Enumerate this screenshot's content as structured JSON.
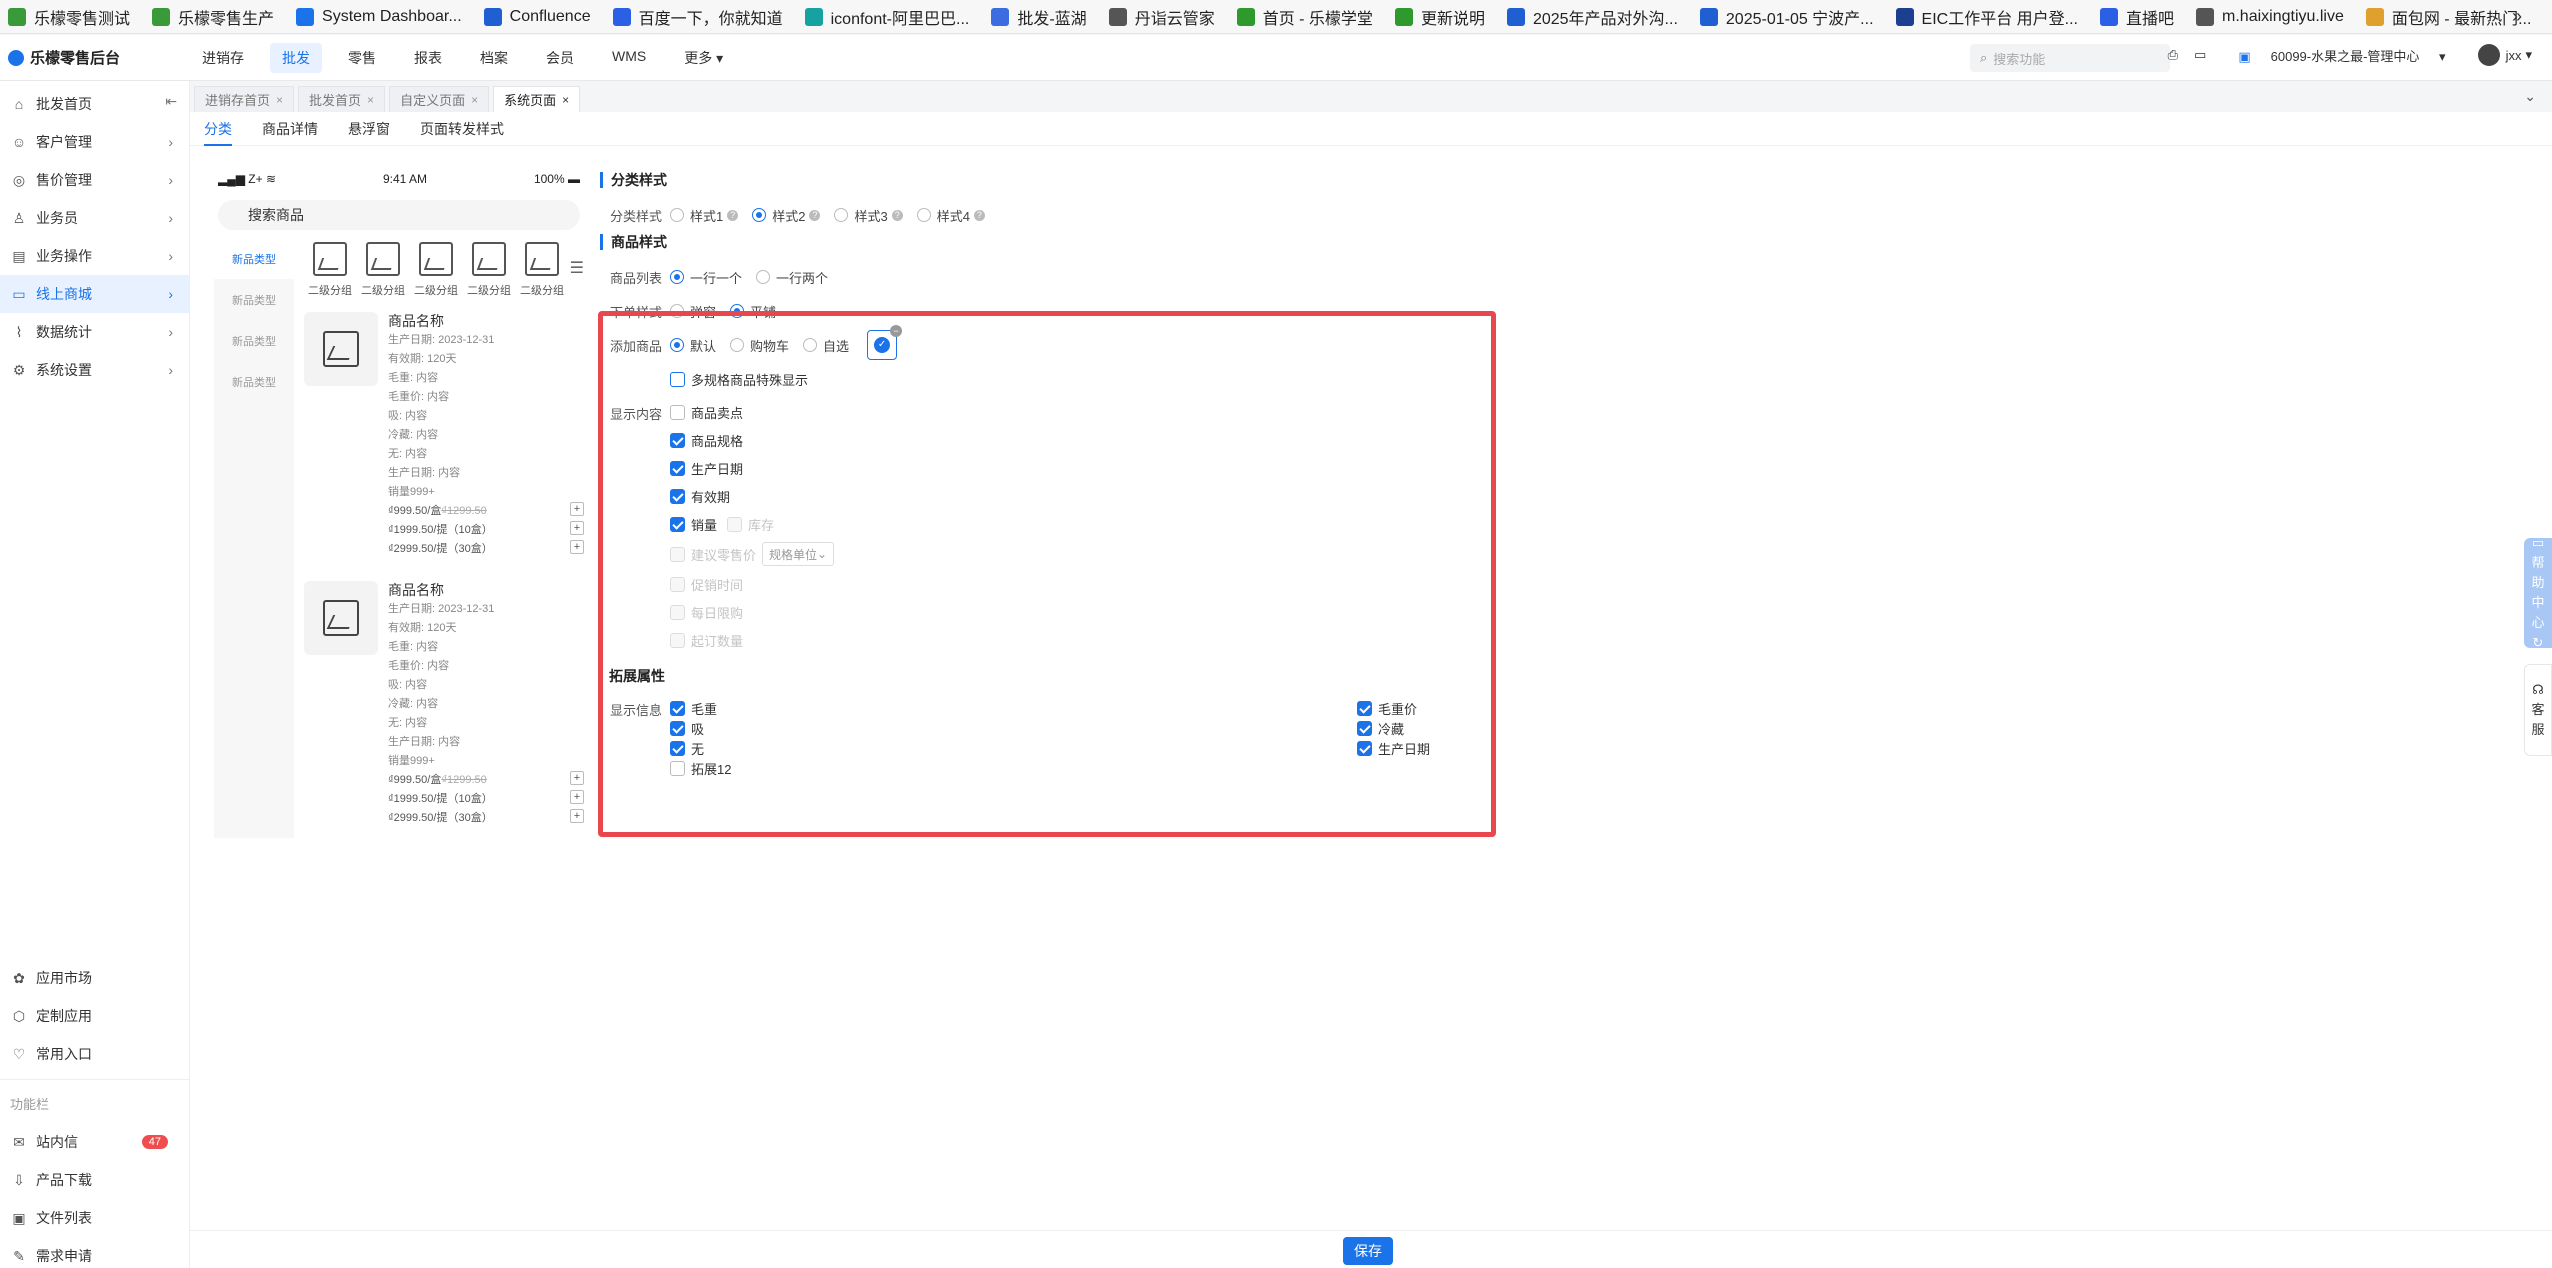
{
  "bookmarks": [
    {
      "label": "乐檬零售测试",
      "color": "#3a9a3a"
    },
    {
      "label": "乐檬零售生产",
      "color": "#3a9a3a"
    },
    {
      "label": "System Dashboar...",
      "color": "#1a73e8"
    },
    {
      "label": "Confluence",
      "color": "#1f5fd1"
    },
    {
      "label": "百度一下，你就知道",
      "color": "#2b60e6"
    },
    {
      "label": "iconfont-阿里巴巴...",
      "color": "#17a2a2"
    },
    {
      "label": "批发-蓝湖",
      "color": "#3b6de0"
    },
    {
      "label": "丹诣云管家",
      "color": "#555555"
    },
    {
      "label": "首页 - 乐檬学堂",
      "color": "#2e9a2e"
    },
    {
      "label": "更新说明",
      "color": "#2e9a2e"
    },
    {
      "label": "2025年产品对外沟...",
      "color": "#1f5fd1"
    },
    {
      "label": "2025-01-05 宁波产...",
      "color": "#1f5fd1"
    },
    {
      "label": "EIC工作平台 用户登...",
      "color": "#1c3f8f"
    },
    {
      "label": "直播吧",
      "color": "#2b60e6"
    },
    {
      "label": "m.haixingtiyu.live",
      "color": "#555555"
    },
    {
      "label": "面包网 - 最新热门...",
      "color": "#e0a030"
    }
  ],
  "bookmarks_more": "»",
  "app": {
    "title": "乐檬零售后台"
  },
  "topnav": [
    "进销存",
    "批发",
    "零售",
    "报表",
    "档案",
    "会员",
    "WMS",
    "更多"
  ],
  "topnav_active": 1,
  "search": {
    "placeholder": "搜索功能"
  },
  "top_right": {
    "store": "60099-水果之最-管理中心",
    "user": "jxx"
  },
  "sidebar": {
    "items": [
      {
        "label": "批发首页",
        "icon": "home-icon",
        "glyph": "⌂"
      },
      {
        "label": "客户管理",
        "icon": "user-icon",
        "glyph": "☺"
      },
      {
        "label": "售价管理",
        "icon": "price-icon",
        "glyph": "◎"
      },
      {
        "label": "业务员",
        "icon": "person-icon",
        "glyph": "♙"
      },
      {
        "label": "业务操作",
        "icon": "operation-icon",
        "glyph": "▤"
      },
      {
        "label": "线上商城",
        "icon": "shop-icon",
        "glyph": "▭"
      },
      {
        "label": "数据统计",
        "icon": "stats-icon",
        "glyph": "⌇"
      },
      {
        "label": "系统设置",
        "icon": "settings-icon",
        "glyph": "⚙"
      }
    ],
    "active": 5,
    "bottom": [
      {
        "label": "应用市场",
        "icon": "app-market-icon",
        "glyph": "✿"
      },
      {
        "label": "定制应用",
        "icon": "custom-app-icon",
        "glyph": "⬡"
      },
      {
        "label": "常用入口",
        "icon": "heart-icon",
        "glyph": "♡"
      }
    ],
    "section": "功能栏",
    "tools": [
      {
        "label": "站内信",
        "icon": "message-icon",
        "glyph": "✉",
        "badge": "47"
      },
      {
        "label": "产品下载",
        "icon": "download-icon",
        "glyph": "⇩"
      },
      {
        "label": "文件列表",
        "icon": "file-icon",
        "glyph": "▣"
      },
      {
        "label": "需求申请",
        "icon": "request-icon",
        "glyph": "✎"
      }
    ]
  },
  "page_tabs": [
    {
      "label": "进销存首页"
    },
    {
      "label": "批发首页"
    },
    {
      "label": "自定义页面"
    },
    {
      "label": "系统页面"
    }
  ],
  "page_tabs_active": 3,
  "sub_tabs": [
    "分类",
    "商品详情",
    "悬浮窗",
    "页面转发样式"
  ],
  "sub_tabs_active": 0,
  "phone": {
    "carrier": "Z+",
    "time": "9:41 AM",
    "battery": "100%",
    "search": "搜索商品",
    "categories": [
      "新品类型",
      "新品类型",
      "新品类型",
      "新品类型"
    ],
    "sub_categories": [
      "二级分组",
      "二级分组",
      "二级分组",
      "二级分组",
      "二级分组"
    ],
    "products": [
      {
        "name": "商品名称",
        "lines": [
          "生产日期: 2023-12-31",
          "有效期: 120天",
          "毛重: 内容",
          "毛重价: 内容",
          "吸: 内容",
          "冷藏: 内容",
          "无: 内容",
          "生产日期: 内容",
          "销量999+"
        ],
        "prices": [
          {
            "text": "₫999.50/盒",
            "del": "₫1299.50"
          },
          {
            "text": "₫1999.50/提（10盒）",
            "del": ""
          },
          {
            "text": "₫2999.50/提（30盒）",
            "del": ""
          }
        ]
      },
      {
        "name": "商品名称",
        "lines": [
          "生产日期: 2023-12-31",
          "有效期: 120天",
          "毛重: 内容",
          "毛重价: 内容",
          "吸: 内容",
          "冷藏: 内容",
          "无: 内容",
          "生产日期: 内容",
          "销量999+"
        ],
        "prices": [
          {
            "text": "₫999.50/盒",
            "del": "₫1299.50"
          },
          {
            "text": "₫1999.50/提（10盒）",
            "del": ""
          },
          {
            "text": "₫2999.50/提（30盒）",
            "del": ""
          }
        ]
      }
    ]
  },
  "settings": {
    "cat_style_title": "分类样式",
    "cat_style_label": "分类样式",
    "cat_styles": [
      "样式1",
      "样式2",
      "样式3",
      "样式4"
    ],
    "cat_style_selected": 1,
    "goods_style_title": "商品样式",
    "list_label": "商品列表",
    "list_options": [
      "一行一个",
      "一行两个"
    ],
    "list_selected": 0,
    "order_label": "下单样式",
    "order_options": [
      "弹窗",
      "平铺"
    ],
    "order_selected": 1,
    "add_label": "添加商品",
    "add_options": [
      "默认",
      "购物车",
      "自选"
    ],
    "add_selected": 0,
    "multi_spec": "多规格商品特殊显示",
    "display_label": "显示内容",
    "display_items": [
      {
        "label": "商品卖点",
        "checked": false,
        "disabled": false
      },
      {
        "label": "商品规格",
        "checked": true,
        "disabled": false
      },
      {
        "label": "生产日期",
        "checked": true,
        "disabled": false
      },
      {
        "label": "有效期",
        "checked": true,
        "disabled": false
      }
    ],
    "sales": {
      "label": "销量",
      "checked": true
    },
    "stock": {
      "label": "库存",
      "checked": false
    },
    "suggest_price": "建议零售价",
    "spec_unit": "规格单位",
    "disabled_items": [
      "促销时间",
      "每日限购",
      "起订数量"
    ],
    "ext_title": "拓展属性",
    "info_label": "显示信息",
    "ext_left": [
      {
        "label": "毛重",
        "checked": true
      },
      {
        "label": "吸",
        "checked": true
      },
      {
        "label": "无",
        "checked": true
      },
      {
        "label": "拓展12",
        "checked": false
      }
    ],
    "ext_right": [
      {
        "label": "毛重价",
        "checked": true
      },
      {
        "label": "冷藏",
        "checked": true
      },
      {
        "label": "生产日期",
        "checked": true
      }
    ]
  },
  "save_label": "保存",
  "help_tab": "帮助中心",
  "service_tab": "客服"
}
